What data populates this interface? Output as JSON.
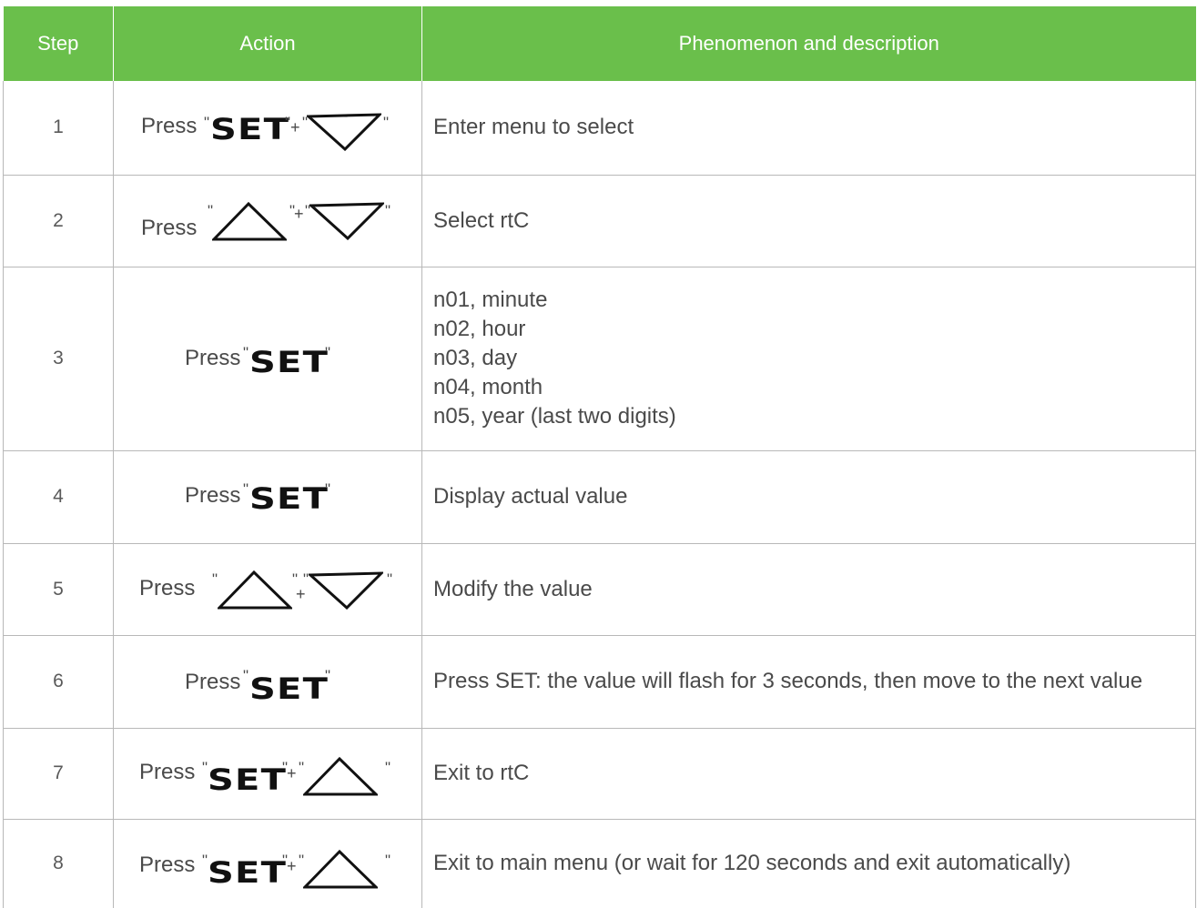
{
  "headers": {
    "step": "Step",
    "action": "Action",
    "description": "Phenomenon and description"
  },
  "press_label": "Press",
  "set_label": "SET",
  "quote": "\"",
  "plus": "+",
  "rows": [
    {
      "step": "1",
      "description": "Enter menu to select"
    },
    {
      "step": "2",
      "description": "Select  rtC"
    },
    {
      "step": "3",
      "description_lines": [
        "n01, minute",
        "n02, hour",
        "n03, day",
        "n04, month",
        "n05, year (last two digits)"
      ]
    },
    {
      "step": "4",
      "description": "Display actual value"
    },
    {
      "step": "5",
      "description": "Modify the value"
    },
    {
      "step": "6",
      "description": "Press SET: the value will flash for 3 seconds, then move to the next value"
    },
    {
      "step": "7",
      "description": "Exit to  rtC"
    },
    {
      "step": "8",
      "description": "Exit to  main menu (or wait for 120 seconds and exit automatically)"
    }
  ],
  "colors": {
    "header_bg": "#6abf4b",
    "header_text": "#ffffff",
    "border": "#b8b8b8",
    "text": "#4a4a4a"
  }
}
